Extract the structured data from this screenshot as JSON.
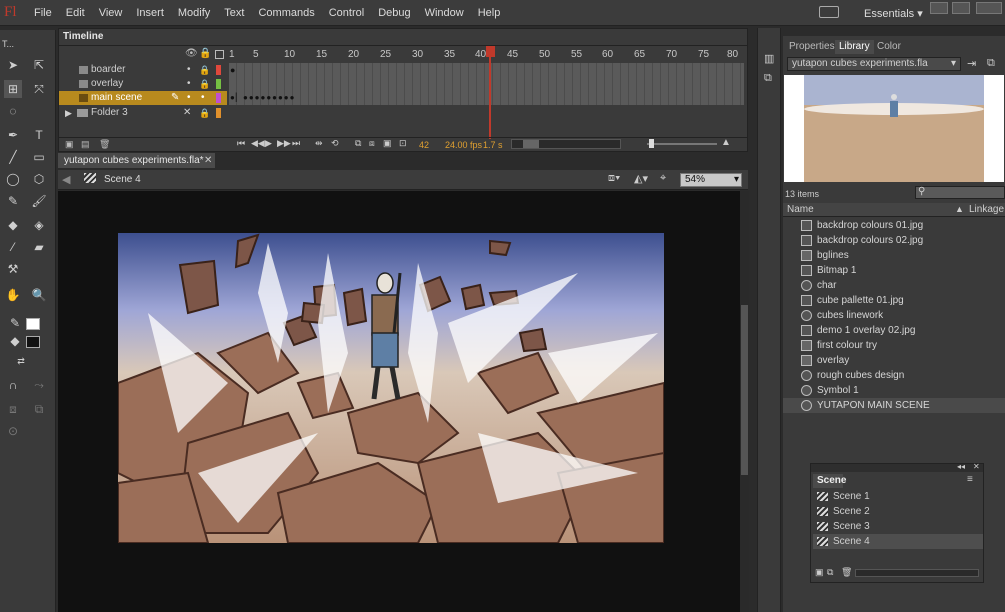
{
  "app": {
    "logo": "Fl",
    "workspace": "Essentials"
  },
  "menu": [
    "File",
    "Edit",
    "View",
    "Insert",
    "Modify",
    "Text",
    "Commands",
    "Control",
    "Debug",
    "Window",
    "Help"
  ],
  "toolbar": {
    "title": "T..."
  },
  "timeline": {
    "tab": "Timeline",
    "frame_numbers": [
      "1",
      "5",
      "10",
      "15",
      "20",
      "25",
      "30",
      "35",
      "40",
      "45",
      "50",
      "55",
      "60",
      "65",
      "70",
      "75",
      "80"
    ],
    "layers": [
      {
        "name": "boarder",
        "color": "#e0483c"
      },
      {
        "name": "overlay",
        "color": "#76c043"
      },
      {
        "name": "main scene",
        "color": "#c04fd0",
        "selected": true
      },
      {
        "name": "Folder 3",
        "color": "#e0902c"
      }
    ],
    "current_frame": "42",
    "fps": "24.00 fps",
    "time": "1.7 s"
  },
  "document": {
    "tab": "yutapon cubes experiments.fla*",
    "scene": "Scene 4",
    "zoom": "54%"
  },
  "library": {
    "tabs": [
      "Properties",
      "Library",
      "Color"
    ],
    "active_tab": "Library",
    "file": "yutapon cubes experiments.fla",
    "count": "13 items",
    "columns": {
      "name": "Name",
      "linkage": "Linkage"
    },
    "items": [
      {
        "label": "backdrop colours 01.jpg",
        "kind": "image-icon"
      },
      {
        "label": "backdrop colours 02.jpg",
        "kind": "image-icon"
      },
      {
        "label": "bglines",
        "kind": "graphic-icon"
      },
      {
        "label": "Bitmap 1",
        "kind": "image-icon"
      },
      {
        "label": "char",
        "kind": "movieclip-icon"
      },
      {
        "label": "cube pallette 01.jpg",
        "kind": "image-icon"
      },
      {
        "label": "cubes linework",
        "kind": "movieclip-icon"
      },
      {
        "label": "demo 1 overlay 02.jpg",
        "kind": "image-icon"
      },
      {
        "label": "first colour try",
        "kind": "graphic-icon"
      },
      {
        "label": "overlay",
        "kind": "graphic-icon"
      },
      {
        "label": "rough cubes design",
        "kind": "movieclip-icon"
      },
      {
        "label": "Symbol 1",
        "kind": "movieclip-icon"
      },
      {
        "label": "YUTAPON MAIN SCENE",
        "kind": "movieclip-icon"
      }
    ]
  },
  "scene_panel": {
    "tab": "Scene",
    "scenes": [
      "Scene 1",
      "Scene 2",
      "Scene 3",
      "Scene 4"
    ],
    "selected": "Scene 4"
  }
}
